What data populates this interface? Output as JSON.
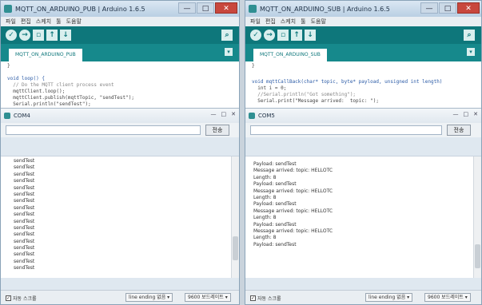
{
  "left": {
    "title": "MQTT_ON_ARDUINO_PUB | Arduino 1.6.5",
    "menu": [
      "파일",
      "편집",
      "스케치",
      "툴",
      "도움말"
    ],
    "tab_label": "MQTT_ON_ARDUINO_PUB",
    "code_lines": [
      "}",
      "",
      "void loop() {",
      "  // Do the MQTT client process event",
      "  mqttClient.loop();",
      "  mqttClient.publish(mqttTopic, \"sendTest\");",
      "  Serial.println(\"sendTest\");"
    ],
    "console_title": "COM4",
    "send_label": "전송",
    "output_lines": [
      "sendTest",
      "sendTest",
      "sendTest",
      "sendTest",
      "sendTest",
      "sendTest",
      "sendTest",
      "sendTest",
      "sendTest",
      "sendTest",
      "sendTest",
      "sendTest",
      "sendTest",
      "sendTest",
      "sendTest",
      "sendTest",
      "sendTest"
    ],
    "autoscroll_label": "자동 스크롤",
    "line_ending": "line ending 없음",
    "baud": "9600 보드레이트"
  },
  "right": {
    "title": "MQTT_ON_ARDUINO_SUB | Arduino 1.6.5",
    "menu": [
      "파일",
      "편집",
      "스케치",
      "툴",
      "도움말"
    ],
    "tab_label": "MQTT_ON_ARDUINO_SUB",
    "code_lines": [
      "}",
      "",
      "void mqttCallBack(char* topic, byte* payload, unsigned int length)",
      "  int i = 0;",
      "  //Serial.println(\"Got something\");",
      "  Serial.print(\"Message arrived:  topic: \");"
    ],
    "console_title": "COM5",
    "send_label": "전송",
    "output_lines": [
      "Payload: sendTest",
      "Message arrived:  topic: HELLOTC",
      "Length: 8",
      "Payload: sendTest",
      "Message arrived:  topic: HELLOTC",
      "Length: 8",
      "Payload: sendTest",
      "Message arrived:  topic: HELLOTC",
      "Length: 8",
      "Payload: sendTest",
      "Message arrived:  topic: HELLOTC",
      "Length: 8",
      "Payload: sendTest"
    ],
    "autoscroll_label": "자동 스크롤",
    "line_ending": "line ending 없음",
    "baud": "9600 보드레이트"
  },
  "window_controls": {
    "minimize": "—",
    "maximize": "□",
    "close": "✕"
  },
  "accent": "#0e777b"
}
